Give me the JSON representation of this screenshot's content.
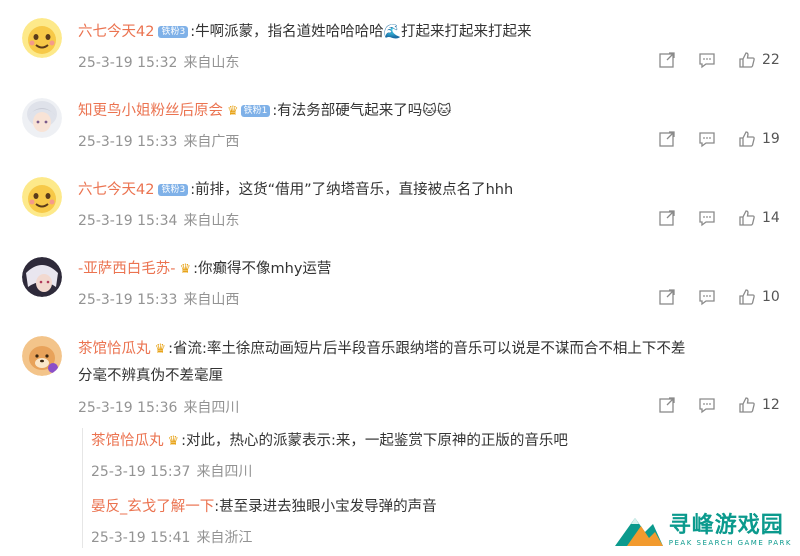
{
  "comments": [
    {
      "username": "六七今天42",
      "badge": "铁粉3",
      "badge_type": "fan",
      "text": ":牛啊派蒙，指名道姓哈哈哈哈",
      "text_after_emoji": "打起来打起来打起来",
      "emoji": "🌊",
      "date": "25-3-19 15:32",
      "location": "来自山东",
      "likes": "22",
      "avatar_icon": "yellow-smile-face"
    },
    {
      "username": "知更鸟小姐粉丝后原会",
      "badge": "铁粉1",
      "badge_type": "fan-crown",
      "text": ":有法务部硬气起来了吗",
      "emoji_tail": "🐱🐱",
      "date": "25-3-19 15:33",
      "location": "来自广西",
      "likes": "19",
      "avatar_icon": "anime-avatar-white-hair"
    },
    {
      "username": "六七今天42",
      "badge": "铁粉3",
      "badge_type": "fan",
      "text": ":前排，这货“借用”了纳塔音乐，直接被点名了hhh",
      "date": "25-3-19 15:34",
      "location": "来自山东",
      "likes": "14",
      "avatar_icon": "yellow-smile-face"
    },
    {
      "username": "-亚萨西白毛苏-",
      "badge_type": "crown",
      "text": ":你癫得不像mhy运营",
      "date": "25-3-19 15:33",
      "location": "来自山西",
      "likes": "10",
      "avatar_icon": "anime-avatar-dark"
    },
    {
      "username": "茶馆恰瓜丸",
      "badge_type": "crown",
      "text_line1": ":省流:率土徐庶动画短片后半段音乐跟纳塔的音乐可以说是不谋而合不相上下不差",
      "text_line2": "分毫不辨真伪不差毫厘",
      "date": "25-3-19 15:36",
      "location": "来自四川",
      "likes": "12",
      "avatar_icon": "dog-avatar"
    }
  ],
  "replies": [
    {
      "username": "茶馆恰瓜丸",
      "badge_type": "crown",
      "text": ":对此，热心的派蒙表示:来，一起鉴赏下原神的正版的音乐吧",
      "date": "25-3-19 15:37",
      "location": "来自四川"
    },
    {
      "username": "晏反_玄戈了解一下",
      "text": ":甚至录进去独眼小宝发导弹的声音",
      "date": "25-3-19 15:41",
      "location": "来自浙江"
    }
  ],
  "icons": {
    "share": "share-icon",
    "comment": "comment-icon",
    "like": "thumbs-up-icon",
    "crown": "crown-badge-icon"
  },
  "colors": {
    "username": "#eb7350",
    "meta": "#939393",
    "fan_badge": "#7fb1e8",
    "watermark": "#0b9a8d"
  },
  "watermark": {
    "title": "寻峰游戏园",
    "subtitle": "PEAK SEARCH GAME PARK"
  }
}
